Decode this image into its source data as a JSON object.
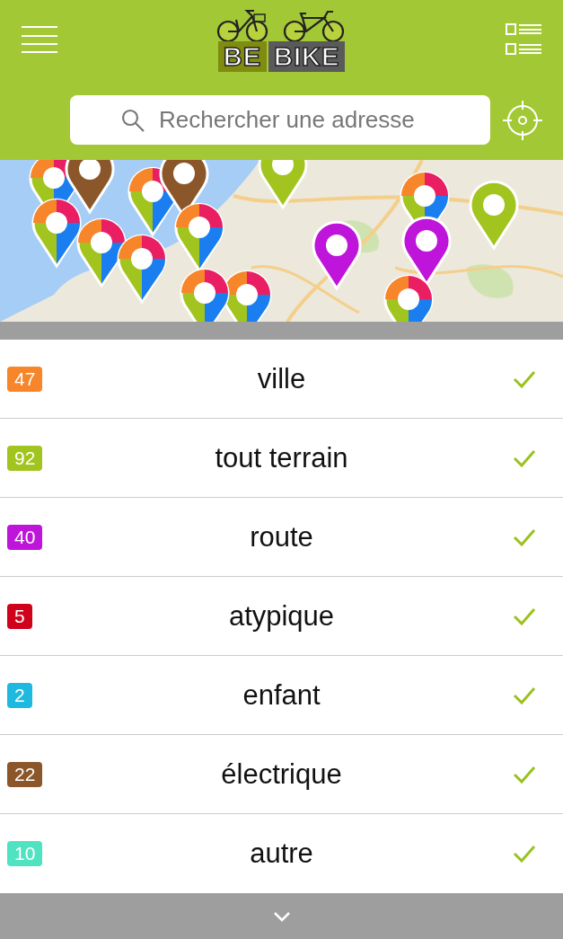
{
  "header": {
    "logo": {
      "word_1": "BE",
      "word_2": "BIKE"
    }
  },
  "search": {
    "placeholder": "Rechercher une adresse"
  },
  "categories": [
    {
      "count": "47",
      "label": "ville",
      "color": "#f7852a",
      "checked": true
    },
    {
      "count": "92",
      "label": "tout terrain",
      "color": "#a2c41e",
      "checked": true
    },
    {
      "count": "40",
      "label": "route",
      "color": "#bf14d9",
      "checked": true
    },
    {
      "count": "5",
      "label": "atypique",
      "color": "#d0021b",
      "checked": true
    },
    {
      "count": "2",
      "label": "enfant",
      "color": "#1fb9e0",
      "checked": true
    },
    {
      "count": "22",
      "label": "électrique",
      "color": "#8b572a",
      "checked": true
    },
    {
      "count": "10",
      "label": "autre",
      "color": "#50e3c2",
      "checked": true
    }
  ]
}
